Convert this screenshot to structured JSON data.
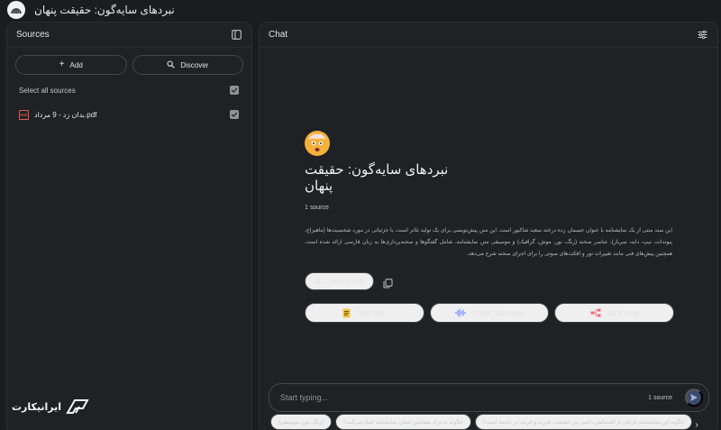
{
  "app": {
    "title": "نبردهای سایه‌گون: حقیقت پنهان"
  },
  "sources_panel": {
    "title": "Sources",
    "add_label": "Add",
    "discover_label": "Discover",
    "select_all_label": "Select all sources",
    "select_all_checked": true,
    "items": [
      {
        "name": "بدان زد - 9 مرداد.pdf",
        "type": "pdf",
        "checked": true
      }
    ]
  },
  "chat_panel": {
    "title": "Chat",
    "notebook_title": "نبردهای سایه‌گون: حقیقت پنهان",
    "source_count": "1 source",
    "summary": "این سند متنی از یک نمایشنامه با عنوان جسمان زده درخته سعید شاکیور است. این متن پیش‌نویسی برای یک تولید تئاتر است، با جزئیاتی در مورد شخصیت‌ها (ماهیزاج، پیوندات، نیپ، دایه، سرباز)، عناصر صحنه (رنگ، نور، موش، گرافیک) و موسیقی متن نمایشنامه. شامل گفتگوها و صحنه‌پردازی‌ها به زبان فارسی ارائه شده است. همچنین پیش‌های فنی مانند تغییرات نور و افکت‌های صوتی را برای اجرای صحنه شرح می‌دهد.",
    "save_note_label": "Save to note",
    "add_note_label": "Add note",
    "audio_overview_label": "Audio Overview",
    "mind_map_label": "Mind map",
    "input_placeholder": "Start typing...",
    "input_source_count": "1 source",
    "suggestions": [
      "چگونه این نمایشنامه بازتابی از کشمکش دائمی بین حقیقت، قدرت و فریب در جامعه است؟",
      "چگونه به درک مضامین اصلی نمایشنامه کمک می‌کنند؟",
      "(رنگ، نور، موسیقی)"
    ]
  },
  "watermark": {
    "text": "ایرانیکارت"
  },
  "colors": {
    "background": "#1b1c1e",
    "panel": "#202124",
    "border": "#444649",
    "pdf_red": "#e05a4e",
    "send_button": "#3c4a70"
  }
}
